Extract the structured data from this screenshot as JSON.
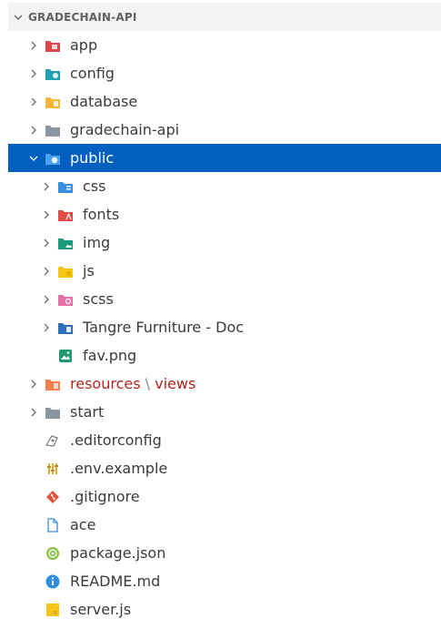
{
  "explorer": {
    "title": "GRADECHAIN-API"
  },
  "tree": {
    "app": "app",
    "config": "config",
    "database": "database",
    "gradechain_api": "gradechain-api",
    "public": "public",
    "css": "css",
    "fonts": "fonts",
    "img": "img",
    "js": "js",
    "scss": "scss",
    "tangre": "Tangre Furniture - Doc",
    "fav": "fav.png",
    "resources": "resources",
    "resources_sep": "\\",
    "views": "views",
    "start": "start",
    "editorconfig": ".editorconfig",
    "env_example": ".env.example",
    "gitignore": ".gitignore",
    "ace": "ace",
    "package_json": "package.json",
    "readme": "README.md",
    "server_js": "server.js"
  },
  "colors": {
    "selection": "#0060c0",
    "modified_text": "#b3261e",
    "modified_dot": "#e0939a"
  }
}
